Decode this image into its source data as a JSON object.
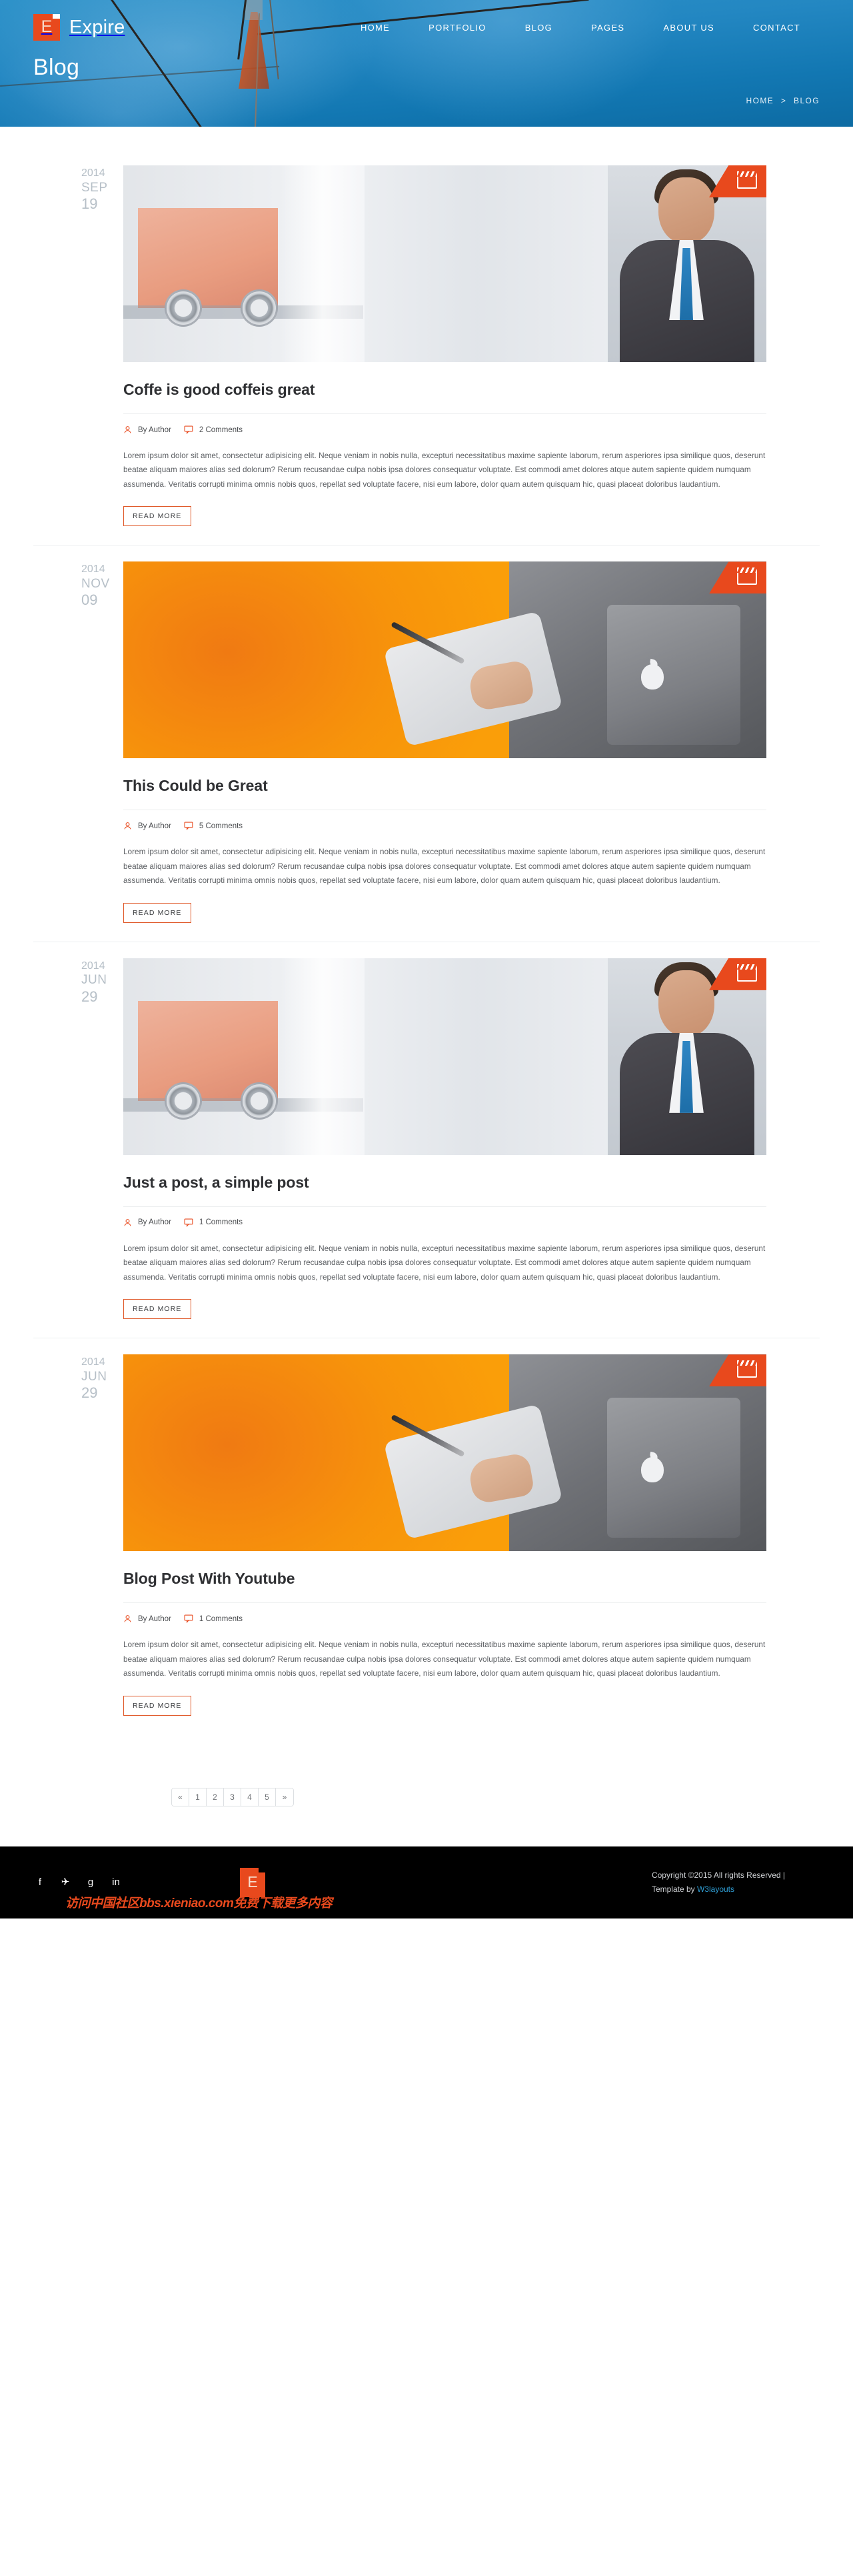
{
  "brand": {
    "logo_letter": "E",
    "name": "Expire",
    "accent_color": "#e8491d",
    "header_color": "#1d7db8"
  },
  "nav": {
    "items": [
      {
        "label": "HOME",
        "name": "nav-item-home"
      },
      {
        "label": "PORTFOLIO",
        "name": "nav-item-portfolio"
      },
      {
        "label": "BLOG",
        "name": "nav-item-blog"
      },
      {
        "label": "PAGES",
        "name": "nav-item-pages"
      },
      {
        "label": "ABOUT US",
        "name": "nav-item-about-us"
      },
      {
        "label": "CONTACT",
        "name": "nav-item-contact"
      }
    ]
  },
  "page": {
    "title": "Blog",
    "breadcrumb": {
      "home": "HOME",
      "separator": ">",
      "current": "BLOG"
    }
  },
  "posts": [
    {
      "date": {
        "year": "2014",
        "month": "SEP",
        "day": "19"
      },
      "title": "Coffe is good coffeis great",
      "ribbon_icon": "film-clapper-icon",
      "media": "truck",
      "author": "By Author",
      "comments": "2 Comments",
      "text": "Lorem ipsum dolor sit amet, consectetur adipisicing elit. Neque veniam in nobis nulla, excepturi necessitatibus maxime sapiente laborum, rerum asperiores ipsa similique quos, deserunt beatae aliquam maiores alias sed dolorum? Rerum recusandae culpa nobis ipsa dolores consequatur voluptate. Est commodi amet dolores atque autem sapiente quidem numquam assumenda. Veritatis corrupti minima omnis nobis quos, repellat sed voluptate facere, nisi eum labore, dolor quam autem quisquam hic, quasi placeat doloribus laudantium.",
      "read_more": "READ MORE"
    },
    {
      "date": {
        "year": "2014",
        "month": "NOV",
        "day": "09"
      },
      "title": "This Could be Great",
      "ribbon_icon": "film-clapper-icon",
      "media": "orange",
      "author": "By Author",
      "comments": "5 Comments",
      "text": "Lorem ipsum dolor sit amet, consectetur adipisicing elit. Neque veniam in nobis nulla, excepturi necessitatibus maxime sapiente laborum, rerum asperiores ipsa similique quos, deserunt beatae aliquam maiores alias sed dolorum? Rerum recusandae culpa nobis ipsa dolores consequatur voluptate. Est commodi amet dolores atque autem sapiente quidem numquam assumenda. Veritatis corrupti minima omnis nobis quos, repellat sed voluptate facere, nisi eum labore, dolor quam autem quisquam hic, quasi placeat doloribus laudantium.",
      "read_more": "READ MORE"
    },
    {
      "date": {
        "year": "2014",
        "month": "JUN",
        "day": "29"
      },
      "title": "Just a post, a simple post",
      "ribbon_icon": "film-clapper-icon",
      "media": "truck",
      "author": "By Author",
      "comments": "1 Comments",
      "text": "Lorem ipsum dolor sit amet, consectetur adipisicing elit. Neque veniam in nobis nulla, excepturi necessitatibus maxime sapiente laborum, rerum asperiores ipsa similique quos, deserunt beatae aliquam maiores alias sed dolorum? Rerum recusandae culpa nobis ipsa dolores consequatur voluptate. Est commodi amet dolores atque autem sapiente quidem numquam assumenda. Veritatis corrupti minima omnis nobis quos, repellat sed voluptate facere, nisi eum labore, dolor quam autem quisquam hic, quasi placeat doloribus laudantium.",
      "read_more": "READ MORE"
    },
    {
      "date": {
        "year": "2014",
        "month": "JUN",
        "day": "29"
      },
      "title": "Blog Post With Youtube",
      "ribbon_icon": "film-clapper-icon",
      "media": "orange",
      "author": "By Author",
      "comments": "1 Comments",
      "text": "Lorem ipsum dolor sit amet, consectetur adipisicing elit. Neque veniam in nobis nulla, excepturi necessitatibus maxime sapiente laborum, rerum asperiores ipsa similique quos, deserunt beatae aliquam maiores alias sed dolorum? Rerum recusandae culpa nobis ipsa dolores consequatur voluptate. Est commodi amet dolores atque autem sapiente quidem numquam assumenda. Veritatis corrupti minima omnis nobis quos, repellat sed voluptate facere, nisi eum labore, dolor quam autem quisquam hic, quasi placeat doloribus laudantium.",
      "read_more": "READ MORE"
    }
  ],
  "pagination": {
    "prev": "«",
    "pages": [
      "1",
      "2",
      "3",
      "4",
      "5"
    ],
    "next": "»"
  },
  "footer": {
    "social": [
      {
        "name": "facebook-icon",
        "glyph": "f"
      },
      {
        "name": "twitter-icon",
        "glyph": "✈"
      },
      {
        "name": "google-plus-icon",
        "glyph": "g"
      },
      {
        "name": "linkedin-icon",
        "glyph": "in"
      }
    ],
    "logo_letter": "E",
    "watermark": "访问中国社区bbs.xieniao.com免费下载更多内容",
    "copyright": "Copyright ©2015 All rights Reserved |",
    "template_prefix": "Template by ",
    "template_link": "W3layouts"
  }
}
